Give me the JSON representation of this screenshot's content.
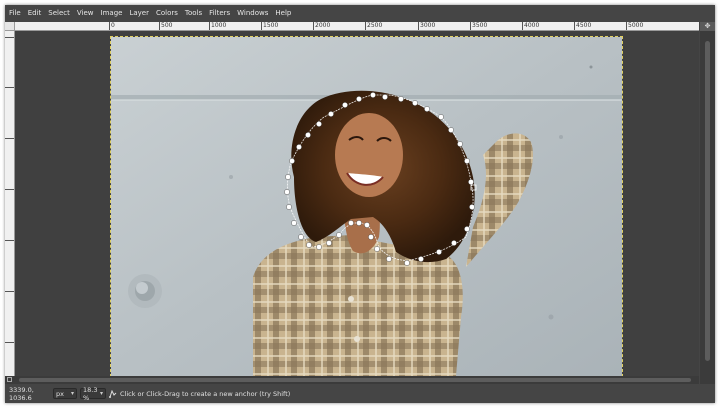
{
  "menubar": {
    "items": [
      "File",
      "Edit",
      "Select",
      "View",
      "Image",
      "Layer",
      "Colors",
      "Tools",
      "Filters",
      "Windows",
      "Help"
    ]
  },
  "ruler": {
    "top_labels": [
      "0",
      "500",
      "1000",
      "1500",
      "2000",
      "2500",
      "3000",
      "3500",
      "4000",
      "4500",
      "5000"
    ],
    "left_labels": [
      "0",
      "500",
      "1000",
      "1500",
      "2000",
      "2500",
      "3000"
    ]
  },
  "statusbar": {
    "coordinates": "3339.0, 1036.6",
    "unit": "px",
    "zoom": "18.3 %",
    "message": "Click or Click-Drag to create a new anchor (try Shift)",
    "icon": "tool-icon"
  },
  "colors": {
    "window_bg": "#454545",
    "canvas_bg": "#404040",
    "path_anchor": "#ffffff",
    "path_line": "#ffffff"
  }
}
